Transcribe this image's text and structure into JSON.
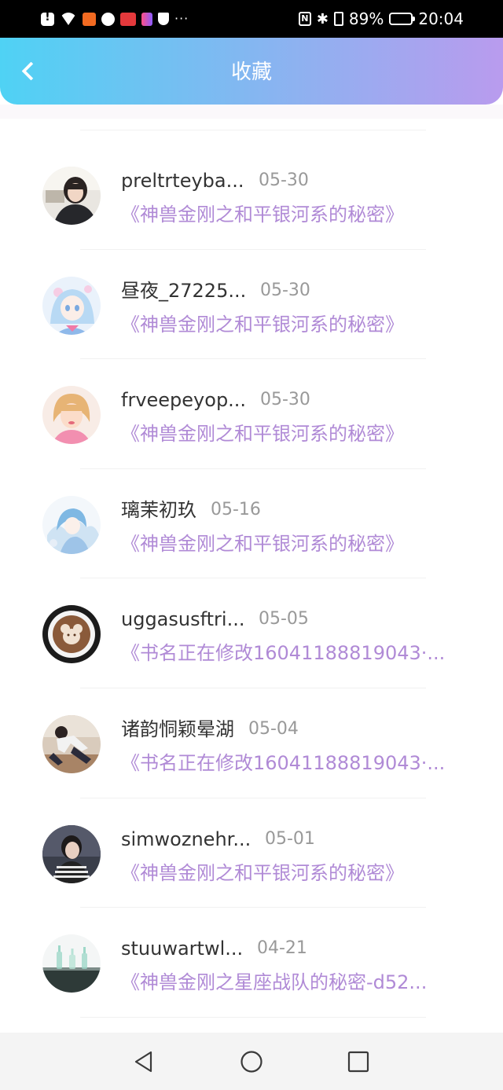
{
  "status_bar": {
    "battery": "89%",
    "battery_level": 0.89,
    "time": "20:04",
    "left_icons": [
      "alert-icon",
      "wifi-icon",
      "download-icon",
      "app-icon",
      "app-red-icon",
      "book-app-icon",
      "shield-icon"
    ],
    "more": "···"
  },
  "header": {
    "title": "收藏",
    "gradient_start": "#4fd2f4",
    "gradient_end": "#b99bee"
  },
  "accent_color": "#b08ad6",
  "items": [
    {
      "name": "preltrteyba...",
      "date": "05-30",
      "book": "《神兽金刚之和平银河系的秘密》",
      "avatar": "portrait-girl-photo"
    },
    {
      "name": "昼夜_27225...",
      "date": "05-30",
      "book": "《神兽金刚之和平银河系的秘密》",
      "avatar": "anime-girl-illustration"
    },
    {
      "name": "frveepeyop...",
      "date": "05-30",
      "book": "《神兽金刚之和平银河系的秘密》",
      "avatar": "blonde-girl-photo"
    },
    {
      "name": "璃茉初玖",
      "date": "05-16",
      "book": "《神兽金刚之和平银河系的秘密》",
      "avatar": "anime-character-illustration"
    },
    {
      "name": "uggasusftri...",
      "date": "05-05",
      "book": "《书名正在修改16041188819043·...",
      "avatar": "latte-art-cup"
    },
    {
      "name": "诸韵恫颖晕湖",
      "date": "05-04",
      "book": "《书名正在修改16041188819043·...",
      "avatar": "street-pose-photo"
    },
    {
      "name": "simwoznehr...",
      "date": "05-01",
      "book": "《神兽金刚之和平银河系的秘密》",
      "avatar": "striped-shirt-portrait"
    },
    {
      "name": "stuuwartwl...",
      "date": "04-21",
      "book": "《神兽金刚之星座战队的秘密-d52...",
      "avatar": "glass-bottles-photo"
    }
  ],
  "nav": {
    "icons": [
      "back-triangle-icon",
      "home-circle-icon",
      "recent-square-icon"
    ]
  }
}
